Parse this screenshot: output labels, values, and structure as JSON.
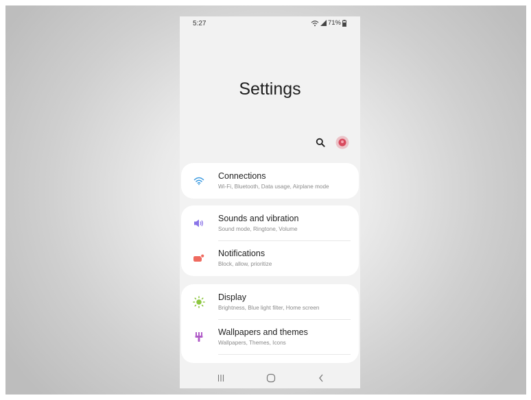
{
  "status_bar": {
    "time": "5:27",
    "battery": "71%"
  },
  "header": {
    "title": "Settings"
  },
  "toolbar": {
    "search_icon": "search-icon",
    "profile_icon": "avatar"
  },
  "groups": [
    {
      "items": [
        {
          "title": "Connections",
          "subtitle": "Wi-Fi, Bluetooth, Data usage, Airplane mode",
          "icon": "wifi-icon",
          "icon_color": "#3b9ae0"
        }
      ]
    },
    {
      "items": [
        {
          "title": "Sounds and vibration",
          "subtitle": "Sound mode, Ringtone, Volume",
          "icon": "speaker-icon",
          "icon_color": "#8a74e8"
        },
        {
          "title": "Notifications",
          "subtitle": "Block, allow, prioritize",
          "icon": "notification-icon",
          "icon_color": "#ef6a5f"
        }
      ]
    },
    {
      "items": [
        {
          "title": "Display",
          "subtitle": "Brightness, Blue light filter, Home screen",
          "icon": "sun-icon",
          "icon_color": "#8cc63f"
        },
        {
          "title": "Wallpapers and themes",
          "subtitle": "Wallpapers, Themes, Icons",
          "icon": "brush-icon",
          "icon_color": "#b05cc8"
        }
      ]
    }
  ],
  "navigation_bar": {
    "recent": "recent-apps-icon",
    "home": "home-icon",
    "back": "back-icon"
  }
}
